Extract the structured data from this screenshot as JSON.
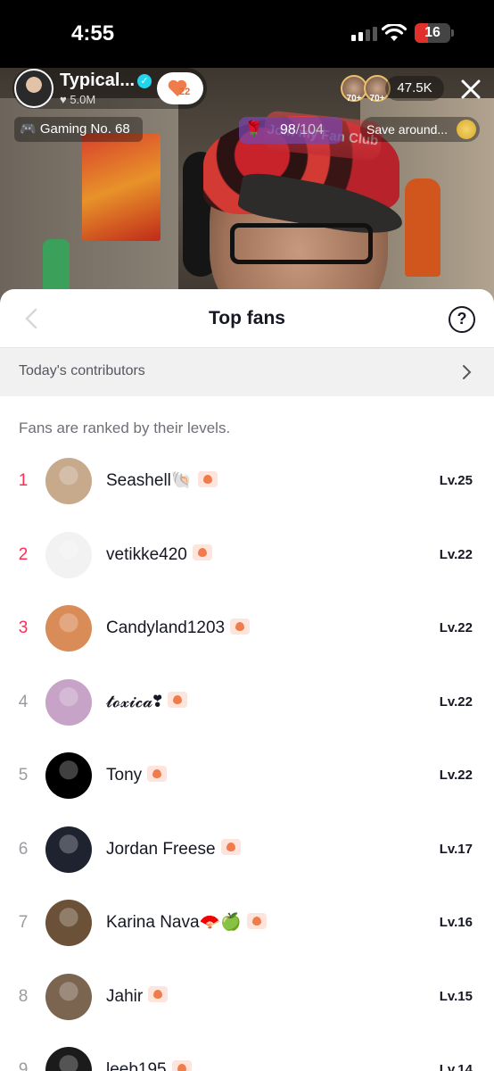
{
  "status_bar": {
    "time": "4:55",
    "battery": "16",
    "battery_level": 0.16
  },
  "live": {
    "host_name": "Typical...",
    "host_likes": "♥ 5.0M",
    "fan_level_badge": "22",
    "viewer_badges": [
      "70+",
      "70+"
    ],
    "viewer_count": "47.5K",
    "category_pill": "🎮 Gaming No. 68",
    "fan_club_progress": "98",
    "fan_club_goal": "/104",
    "join_banner": "Join my Fan Club",
    "save_pill": "Save around..."
  },
  "sheet": {
    "title": "Top fans",
    "contributors_label": "Today's contributors",
    "note": "Fans are ranked by their levels."
  },
  "fans": [
    {
      "rank": "1",
      "name": "Seashell🐚",
      "level": "Lv.25",
      "avatar": "#c7a98c"
    },
    {
      "rank": "2",
      "name": "vetikke420",
      "level": "Lv.22",
      "avatar": "#f2f2f2"
    },
    {
      "rank": "3",
      "name": "Candyland1203",
      "level": "Lv.22",
      "avatar": "#d98b58"
    },
    {
      "rank": "4",
      "name": "𝓽𝓸𝔁𝓲𝓬𝓪❣",
      "level": "Lv.22",
      "avatar": "#c7a3c8"
    },
    {
      "rank": "5",
      "name": "Tony",
      "level": "Lv.22",
      "avatar": "#000000"
    },
    {
      "rank": "6",
      "name": "Jordan Freese",
      "level": "Lv.17",
      "avatar": "#1f2330"
    },
    {
      "rank": "7",
      "name": "Karina Nava🪭🍏",
      "level": "Lv.16",
      "avatar": "#6b5138"
    },
    {
      "rank": "8",
      "name": "Jahir",
      "level": "Lv.15",
      "avatar": "#7b6450"
    },
    {
      "rank": "9",
      "name": "leeb195",
      "level": "Lv.14",
      "avatar": "#1b1b1b"
    }
  ],
  "colors": {
    "accent": "#fe2c55",
    "fan_badge": "#ef7c4a",
    "verified": "#20d5ec"
  },
  "icons": [
    "back-chevron-icon",
    "help-icon",
    "chevron-right-icon",
    "close-icon",
    "wifi-icon",
    "signal-icon",
    "battery-icon",
    "verified-icon",
    "heart-icon",
    "rose-icon",
    "coin-icon",
    "fan-badge-icon"
  ]
}
